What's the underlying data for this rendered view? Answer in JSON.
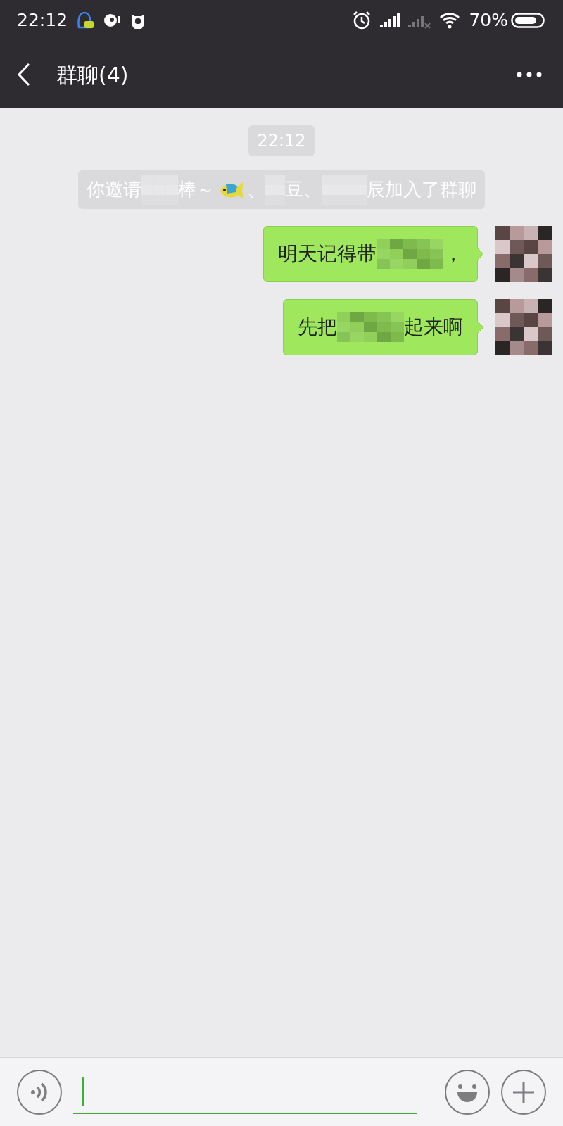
{
  "status_bar": {
    "time": "22:12",
    "battery": "70%"
  },
  "header": {
    "title": "群聊(4)"
  },
  "messages": [
    {
      "kind": "time",
      "text": "22:12"
    },
    {
      "kind": "system",
      "parts": [
        {
          "kind": "text",
          "text": "你邀请"
        },
        {
          "kind": "redacted"
        },
        {
          "kind": "text",
          "text": "棒～"
        },
        {
          "kind": "emoji"
        },
        {
          "kind": "text",
          "text": "、"
        },
        {
          "kind": "redacted"
        },
        {
          "kind": "text",
          "text": "豆、"
        },
        {
          "kind": "redacted"
        },
        {
          "kind": "text",
          "text": "辰加入了群聊"
        }
      ]
    },
    {
      "kind": "bubble",
      "parts": [
        {
          "kind": "text",
          "text": "明天记得带"
        },
        {
          "kind": "redacted"
        },
        {
          "kind": "text",
          "text": "，"
        }
      ]
    },
    {
      "kind": "bubble",
      "parts": [
        {
          "kind": "text",
          "text": "先把"
        },
        {
          "kind": "redacted"
        },
        {
          "kind": "text",
          "text": "起来啊"
        }
      ]
    }
  ]
}
